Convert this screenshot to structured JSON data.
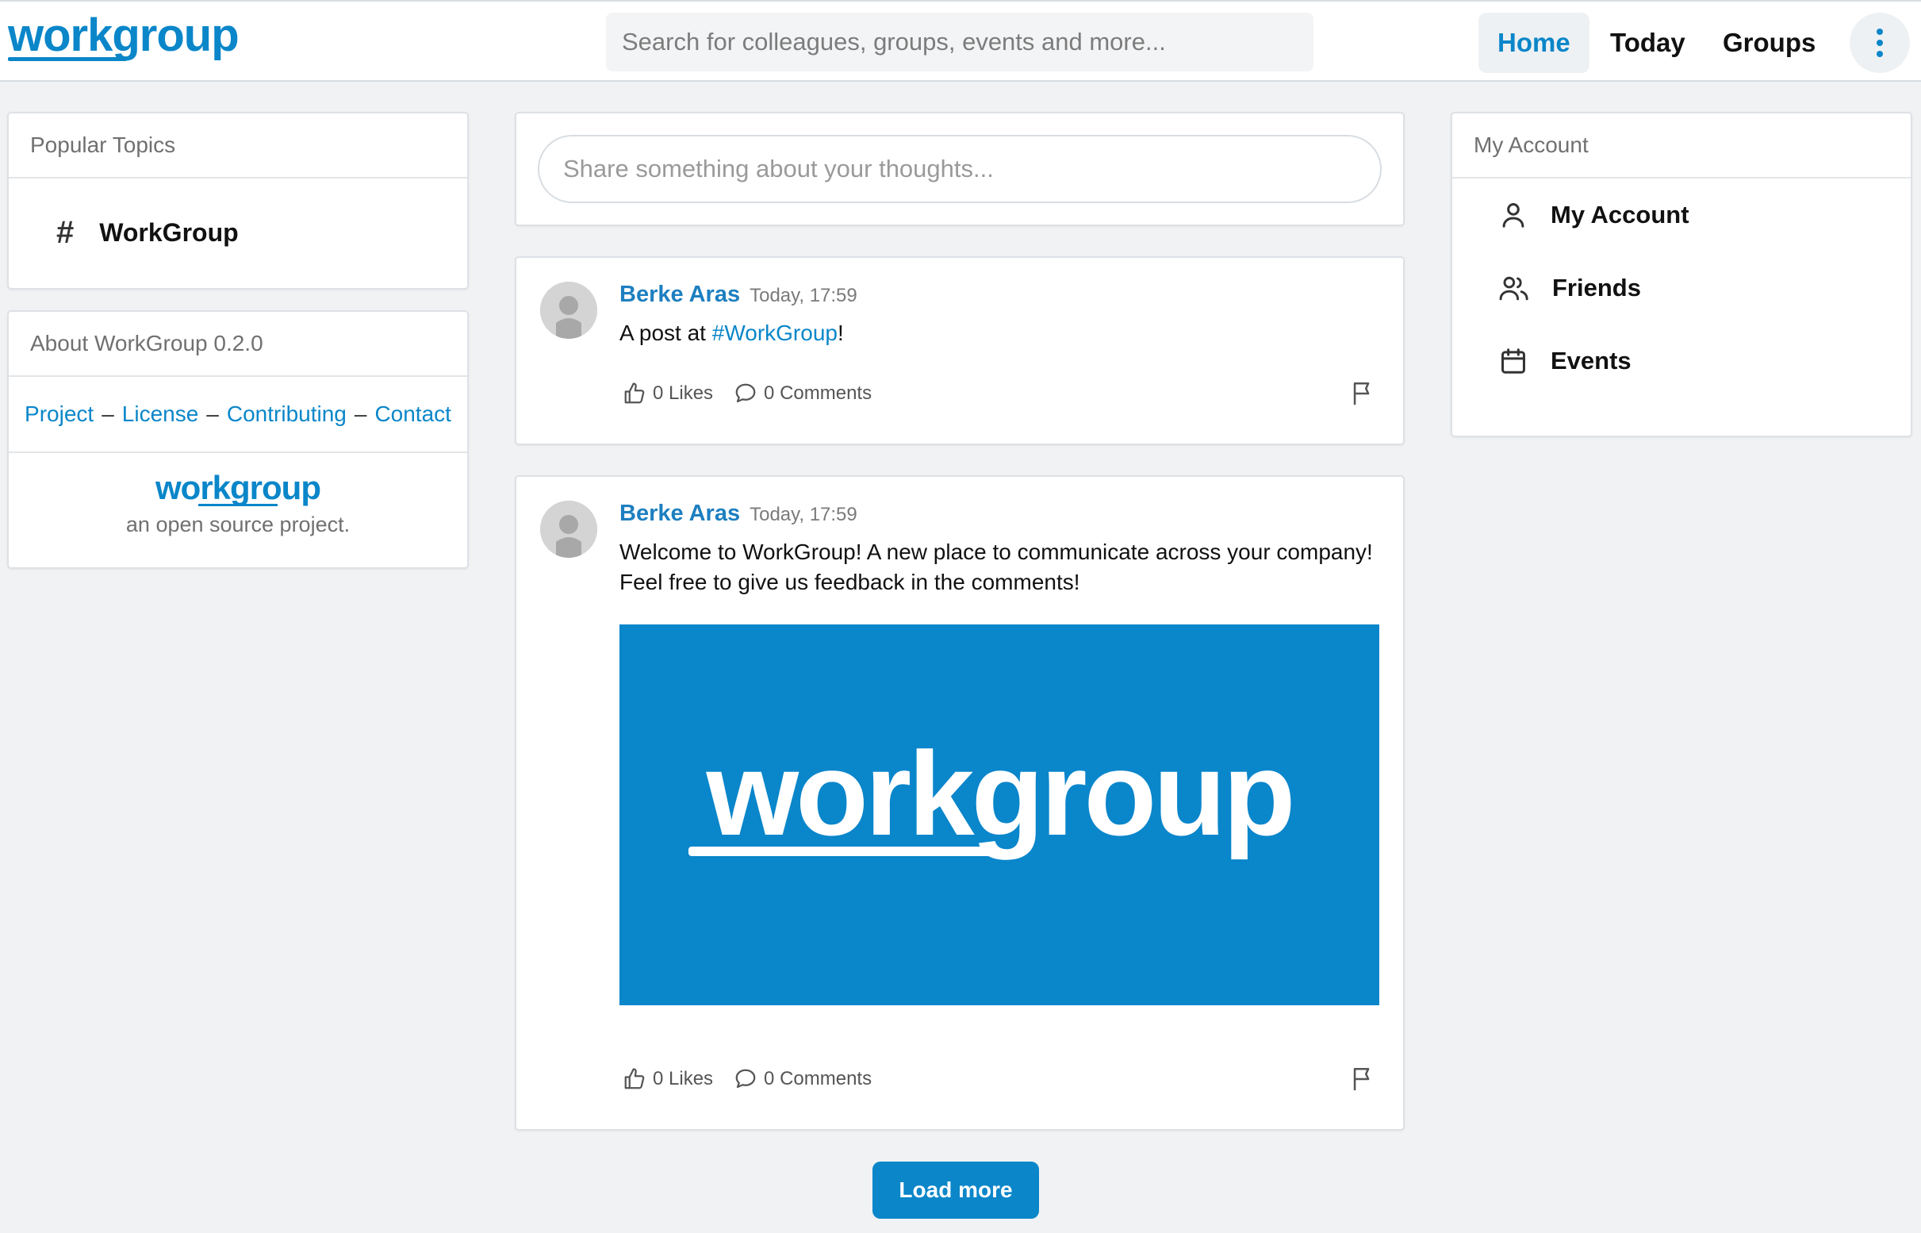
{
  "colors": {
    "accent": "#0a86c9",
    "background": "#f0f2f4",
    "card": "#ffffff"
  },
  "header": {
    "logo": "workgroup",
    "search_placeholder": "Search for colleagues, groups, events and more...",
    "nav": {
      "home": "Home",
      "today": "Today",
      "groups": "Groups"
    },
    "more_icon": "vertical-dots-icon"
  },
  "left": {
    "topics": {
      "title": "Popular Topics",
      "items": [
        {
          "hash": "#",
          "label": "WorkGroup"
        }
      ]
    },
    "about": {
      "title": "About WorkGroup 0.2.0",
      "links": [
        "Project",
        "License",
        "Contributing",
        "Contact"
      ],
      "separator": "–",
      "logo": "workgroup",
      "tagline": "an open source project."
    }
  },
  "composer": {
    "placeholder": "Share something about your thoughts..."
  },
  "posts": [
    {
      "author": "Berke Aras",
      "time": "Today, 17:59",
      "text_before": "A post at ",
      "hashtag": "#WorkGroup",
      "text_after": "!",
      "likes": "0 Likes",
      "comments": "0 Comments"
    },
    {
      "author": "Berke Aras",
      "time": "Today, 17:59",
      "line1": "Welcome to WorkGroup! A new place to communicate across your company!",
      "line2": "Feel free to give us feedback in the comments!",
      "image_logo": "workgroup",
      "likes": "0 Likes",
      "comments": "0 Comments"
    }
  ],
  "load_more": "Load more",
  "right": {
    "title": "My Account",
    "items": [
      {
        "label": "My Account",
        "icon": "user-icon"
      },
      {
        "label": "Friends",
        "icon": "users-icon"
      },
      {
        "label": "Events",
        "icon": "calendar-icon"
      }
    ]
  }
}
